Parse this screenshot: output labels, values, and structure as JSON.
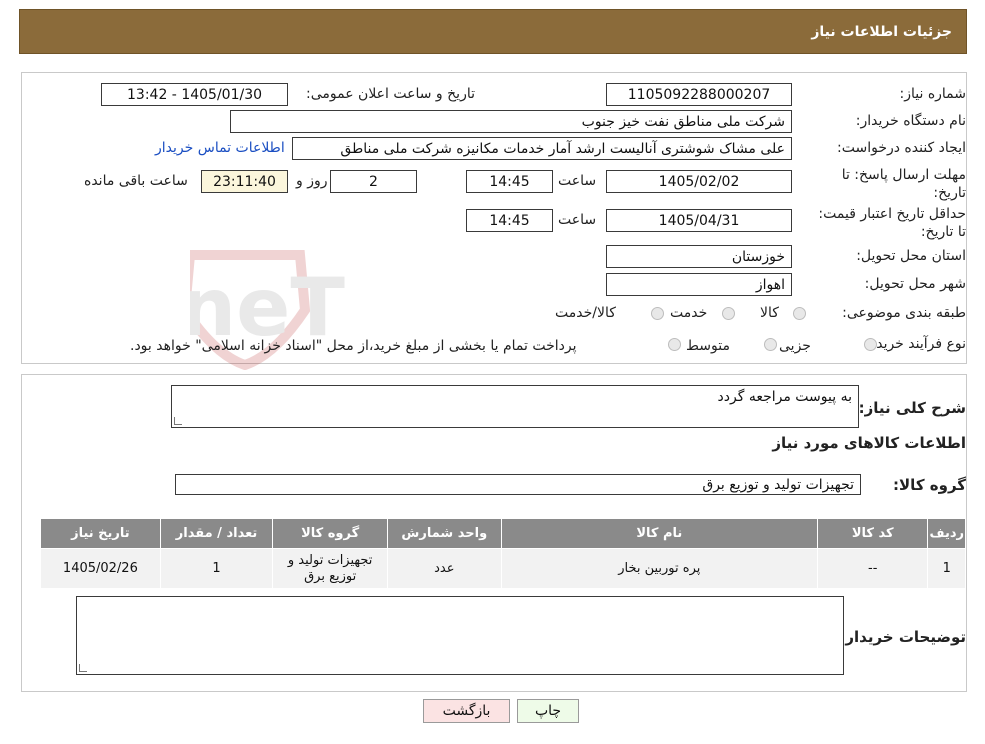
{
  "header": {
    "title": "جزئیات اطلاعات نیاز"
  },
  "form": {
    "need_number_label": "شماره نیاز:",
    "need_number": "1105092288000207",
    "announce_label": "تاریخ و ساعت اعلان عمومی:",
    "announce_value": "1405/01/30 - 13:42",
    "buyer_label": "نام دستگاه خریدار:",
    "buyer_value": "شرکت ملی مناطق نفت خیز جنوب",
    "creator_label": "ایجاد کننده درخواست:",
    "creator_value": "علی  مشاک شوشتری  آنالیست ارشد آمار خدمات مکانیزه شرکت ملی مناطق",
    "contact_link": "اطلاعات تماس خریدار",
    "deadline_label": "مهلت ارسال پاسخ: تا تاریخ:",
    "deadline_date": "1405/02/02",
    "time_label": "ساعت",
    "deadline_time": "14:45",
    "days_value": "2",
    "days_label": "روز و",
    "remaining_value": "23:11:40",
    "remaining_label": "ساعت باقی مانده",
    "validity_label": "حداقل تاریخ اعتبار قیمت: تا تاریخ:",
    "validity_date": "1405/04/31",
    "validity_time": "14:45",
    "province_label": "استان محل تحویل:",
    "province_value": "خوزستان",
    "city_label": "شهر محل تحویل:",
    "city_value": "اهواز",
    "category_label": "طبقه بندی موضوعی:",
    "category_options": [
      "کالا",
      "خدمت",
      "کالا/خدمت"
    ],
    "process_label": "نوع فرآیند خرید :",
    "process_options": [
      "جزیی",
      "متوسط"
    ],
    "process_note": "پرداخت تمام یا بخشی از مبلغ خرید،از محل \"اسناد خزانه اسلامی\" خواهد بود."
  },
  "details": {
    "summary_label": "شرح کلی نیاز:",
    "summary_value": "به پیوست مراجعه گردد",
    "goods_info_title": "اطلاعات کالاهای مورد نیاز",
    "goods_group_label": "گروه کالا:",
    "goods_group_value": "تجهیزات تولید و توزیع برق",
    "table": {
      "headers": [
        "ردیف",
        "کد کالا",
        "نام کالا",
        "واحد شمارش",
        "گروه کالا",
        "تعداد / مقدار",
        "تاریخ نیاز"
      ],
      "rows": [
        [
          "1",
          "--",
          "پره توربین بخار",
          "عدد",
          "تجهیزات تولید و توزیع برق",
          "1",
          "1405/02/26"
        ]
      ]
    },
    "buyer_notes_label": "توضیحات خریدار:",
    "buyer_notes_value": ""
  },
  "actions": {
    "print": "چاپ",
    "back": "بازگشت"
  },
  "watermark": {
    "text": "AriaTender.neT"
  },
  "colors": {
    "header": "#8b6b3a",
    "table_header": "#8a8a8a",
    "print_btn": "#eefbe8",
    "back_btn": "#fbe3e3",
    "link": "#1a4ec2"
  }
}
